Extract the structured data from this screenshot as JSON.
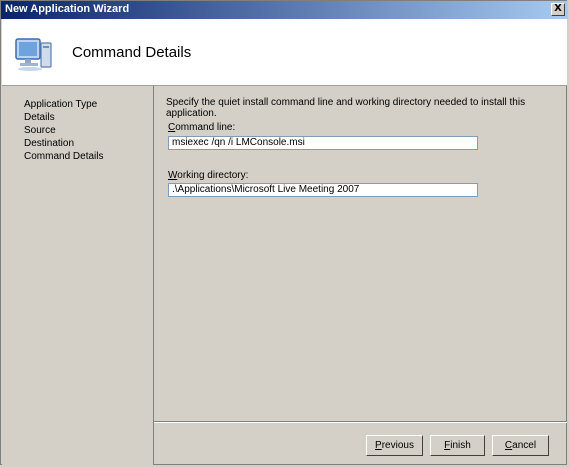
{
  "window": {
    "title": "New Application Wizard",
    "close_glyph": "X"
  },
  "header": {
    "title": "Command Details",
    "icon": "computer-icon"
  },
  "sidebar": {
    "items": [
      {
        "label": "Application Type"
      },
      {
        "label": "Details"
      },
      {
        "label": "Source"
      },
      {
        "label": "Destination"
      },
      {
        "label": "Command Details"
      }
    ]
  },
  "content": {
    "instructions": "Specify the quiet install command line and working directory needed to install this application.",
    "command_line": {
      "label_accel": "C",
      "label_rest": "ommand line:",
      "value": "msiexec /qn /i LMConsole.msi"
    },
    "working_directory": {
      "label_accel": "W",
      "label_rest": "orking directory:",
      "value": ".\\Applications\\Microsoft Live Meeting 2007"
    }
  },
  "buttons": {
    "previous": {
      "accel": "P",
      "rest": "revious"
    },
    "finish": {
      "accel": "F",
      "rest": "inish"
    },
    "cancel": {
      "accel": "C",
      "rest": "ancel"
    }
  }
}
